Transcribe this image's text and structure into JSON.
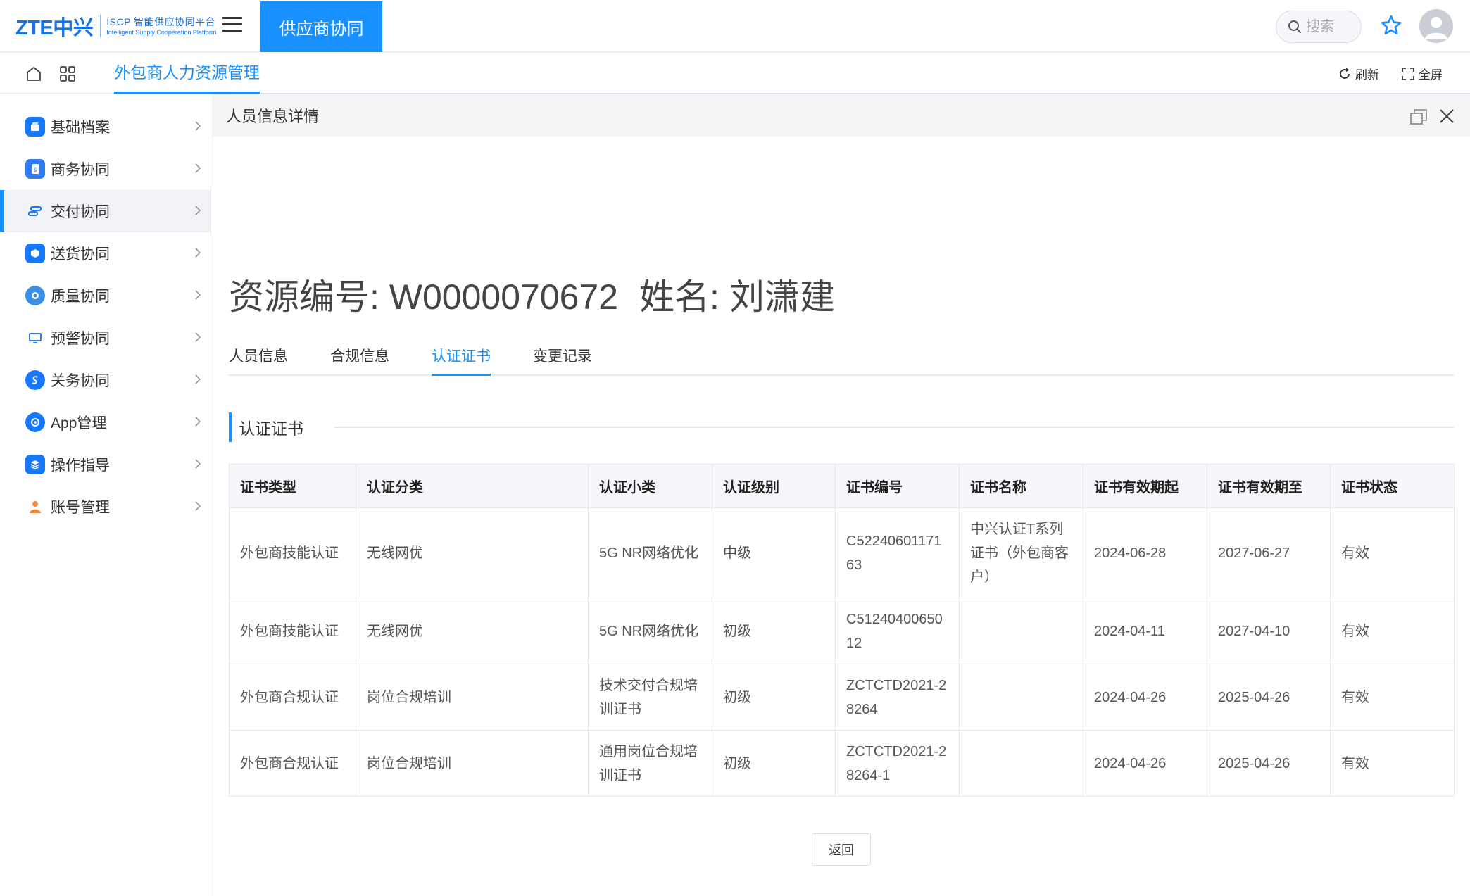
{
  "header": {
    "logo": {
      "brand": "ZTE中兴",
      "line1": "ISCP 智能供应协同平台",
      "line2": "Intelligent Supply Cooperation Platform"
    },
    "active_nav": "供应商协同",
    "search": {
      "placeholder": "搜索",
      "value": ""
    },
    "icons": [
      "menu-icon",
      "search-icon",
      "star-icon",
      "avatar-icon"
    ]
  },
  "tabbar": {
    "module_tab": "外包商人力资源管理",
    "refresh_label": "刷新",
    "fullscreen_label": "全屏"
  },
  "sidebar": {
    "items": [
      {
        "label": "基础档案",
        "icon": "archive-icon",
        "color": "#1677ff",
        "active": false
      },
      {
        "label": "商务协同",
        "icon": "document-icon",
        "color": "#2f7cf6",
        "active": false
      },
      {
        "label": "交付协同",
        "icon": "delivery-icon",
        "color": "#1677ff",
        "active": true
      },
      {
        "label": "送货协同",
        "icon": "box-icon",
        "color": "#1677ff",
        "active": false
      },
      {
        "label": "质量协同",
        "icon": "quality-icon",
        "color": "#3a8ee6",
        "active": false
      },
      {
        "label": "预警协同",
        "icon": "monitor-icon",
        "color": "#2f7cf6",
        "active": false
      },
      {
        "label": "关务协同",
        "icon": "customs-icon",
        "color": "#1677ff",
        "active": false
      },
      {
        "label": "App管理",
        "icon": "app-icon",
        "color": "#1677ff",
        "active": false
      },
      {
        "label": "操作指导",
        "icon": "layers-icon",
        "color": "#1677ff",
        "active": false
      },
      {
        "label": "账号管理",
        "icon": "user-icon",
        "color": "#f0883e",
        "active": false
      }
    ]
  },
  "panel": {
    "title": "人员信息详情",
    "resource_id": "资源编号: W0000070672",
    "person_name": "姓名: 刘潇建",
    "tabs": [
      {
        "label": "人员信息",
        "active": false
      },
      {
        "label": "合规信息",
        "active": false
      },
      {
        "label": "认证证书",
        "active": true
      },
      {
        "label": "变更记录",
        "active": false
      }
    ],
    "section_title": "认证证书",
    "table": {
      "columns": [
        "证书类型",
        "认证分类",
        "认证小类",
        "认证级别",
        "证书编号",
        "证书名称",
        "证书有效期起",
        "证书有效期至",
        "证书状态"
      ],
      "rows": [
        [
          "外包商技能认证",
          "无线网优",
          "5G NR网络优化",
          "中级",
          "C5224060117163",
          "中兴认证T系列证书（外包商客户）",
          "2024-06-28",
          "2027-06-27",
          "有效"
        ],
        [
          "外包商技能认证",
          "无线网优",
          "5G NR网络优化",
          "初级",
          "C5124040065012",
          "",
          "2024-04-11",
          "2027-04-10",
          "有效"
        ],
        [
          "外包商合规认证",
          "岗位合规培训",
          "技术交付合规培训证书",
          "初级",
          "ZCTCTD2021-28264",
          "",
          "2024-04-26",
          "2025-04-26",
          "有效"
        ],
        [
          "外包商合规认证",
          "岗位合规培训",
          "通用岗位合规培训证书",
          "初级",
          "ZCTCTD2021-28264-1",
          "",
          "2024-04-26",
          "2025-04-26",
          "有效"
        ]
      ]
    },
    "back_label": "返回"
  },
  "colors": {
    "accent": "#1890ff",
    "header_bg": "#ffffff",
    "panel_head_bg": "#f4f5f7"
  }
}
